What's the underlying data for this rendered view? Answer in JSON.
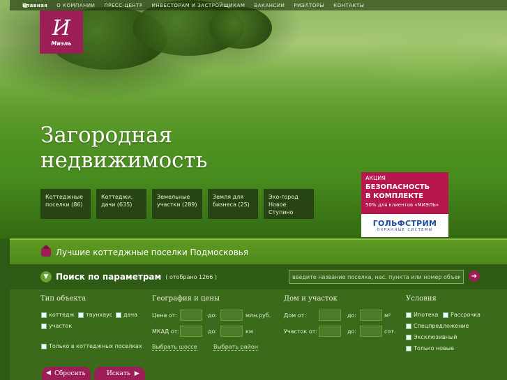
{
  "nav": {
    "items": [
      "Главная",
      "О КОМПАНИИ",
      "ПРЕСС-ЦЕНТР",
      "ИНВЕСТОРАМ И ЗАСТРОЙЩИКАМ",
      "ВАКАНСИИ",
      "РИЭЛТОРЫ",
      "КОНТАКТЫ"
    ]
  },
  "logo": {
    "mark": "И",
    "text": "Миэль"
  },
  "hero": {
    "headline_line1": "Загородная",
    "headline_line2": "недвижимость"
  },
  "categories": [
    "Коттеджные поселки (86)",
    "Коттеджи, дачи (635)",
    "Земельные участки (289)",
    "Земля для бизнеса (25)",
    "Эко-город Новое Ступино"
  ],
  "promo": {
    "tag": "АКЦИЯ",
    "title_line1": "БЕЗОПАСНОСТЬ",
    "title_line2": "В КОМПЛЕКТЕ",
    "sub": "50% для клиентов «МИЭЛЬ»",
    "brand": "ГОЛЬФСТРИМ",
    "brand_sub": "ОХРАННЫЕ СИСТЕМЫ"
  },
  "best": {
    "text": "Лучшие коттеджные поселки Подмосковья"
  },
  "search": {
    "title": "Поиск по параметрам",
    "count": "( отобрано 1266 )",
    "placeholder": "введите название поселка, нас. пункта или номер объекта"
  },
  "filters": {
    "type": {
      "title": "Тип объекта",
      "cottage": "коттедж",
      "townhouse": "таунхаус",
      "dacha": "дача",
      "plot": "участок",
      "only_villages": "Только в коттеджных поселках"
    },
    "geo": {
      "title": "География и цены",
      "price_from": "Цена от:",
      "to": "до:",
      "price_unit": "млн.руб.",
      "mkad_from": "МКАД от:",
      "to2": "до:",
      "km": "км",
      "choose_highway": "Выбрать шоссе",
      "choose_district": "Выбрать район"
    },
    "house": {
      "title": "Дом и участок",
      "house_from": "Дом от:",
      "to": "до:",
      "m2": "м²",
      "plot_from": "Участок от:",
      "to2": "до:",
      "sot": "сот."
    },
    "conditions": {
      "title": "Условия",
      "mortgage": "Ипотека",
      "installment": "Рассрочка",
      "special": "Спецпредложение",
      "exclusive": "Эксклюзивный",
      "new_only": "Только новые"
    }
  },
  "buttons": {
    "reset": "Сбросить",
    "search": "Искать"
  }
}
